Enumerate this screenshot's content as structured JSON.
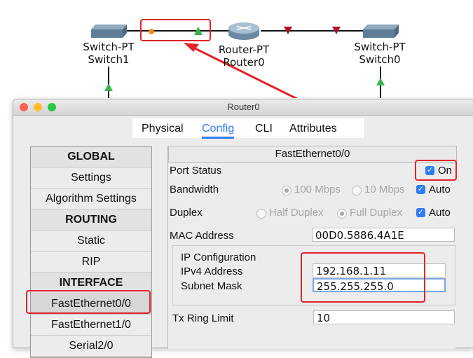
{
  "topology": {
    "switch1": {
      "type": "Switch-PT",
      "name": "Switch1"
    },
    "router": {
      "type": "Router-PT",
      "name": "Router0"
    },
    "switch0": {
      "type": "Switch-PT",
      "name": "Switch0"
    }
  },
  "window": {
    "title": "Router0"
  },
  "tabs": [
    "Physical",
    "Config",
    "CLI",
    "Attributes"
  ],
  "active_tab": "Config",
  "sidebar": {
    "items": [
      {
        "label": "GLOBAL",
        "header": true
      },
      {
        "label": "Settings"
      },
      {
        "label": "Algorithm Settings"
      },
      {
        "label": "ROUTING",
        "header": true
      },
      {
        "label": "Static"
      },
      {
        "label": "RIP"
      },
      {
        "label": "INTERFACE",
        "header": true
      },
      {
        "label": "FastEthernet0/0",
        "selected": true
      },
      {
        "label": "FastEthernet1/0"
      },
      {
        "label": "Serial2/0"
      }
    ]
  },
  "panel": {
    "title": "FastEthernet0/0",
    "port_status_label": "Port Status",
    "port_status_on": "On",
    "bandwidth_label": "Bandwidth",
    "bw_100": "100 Mbps",
    "bw_10": "10 Mbps",
    "bw_auto": "Auto",
    "duplex_label": "Duplex",
    "half": "Half Duplex",
    "full": "Full Duplex",
    "duplex_auto": "Auto",
    "mac_label": "MAC Address",
    "mac": "00D0.5886.4A1E",
    "ip_config_label": "IP Configuration",
    "ipv4_label": "IPv4 Address",
    "ipv4": "192.168.1.11",
    "mask_label": "Subnet Mask",
    "mask": "255.255.255.0",
    "tx_label": "Tx Ring Limit",
    "tx": "10"
  },
  "colors": {
    "accent": "#2f7cf6",
    "highlight": "#e0242a",
    "link_up": "#3bb54a",
    "link_down": "#b0102a"
  }
}
